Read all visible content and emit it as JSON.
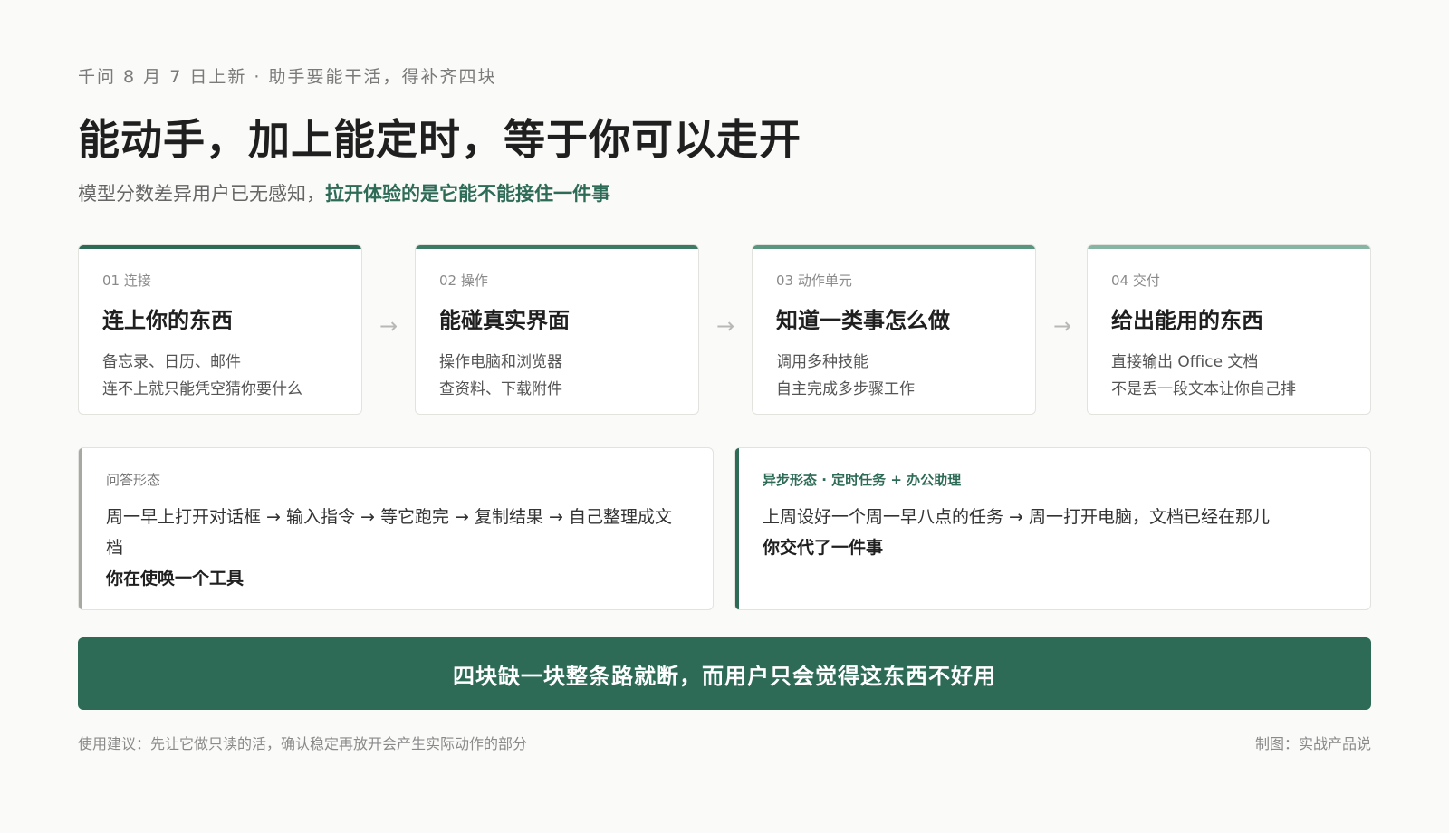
{
  "header": {
    "eyebrow": "千问 8 月 7 日上新 · 助手要能干活，得补齐四块",
    "headline": "能动手，加上能定时，等于你可以走开",
    "subline_plain": "模型分数差异用户已无感知，",
    "subline_highlight": "拉开体验的是它能不能接住一件事"
  },
  "steps": [
    {
      "tag": "01 连接",
      "title": "连上你的东西",
      "desc1": "备忘录、日历、邮件",
      "desc2": "连不上就只能凭空猜你要什么"
    },
    {
      "tag": "02 操作",
      "title": "能碰真实界面",
      "desc1": "操作电脑和浏览器",
      "desc2": "查资料、下载附件"
    },
    {
      "tag": "03 动作单元",
      "title": "知道一类事怎么做",
      "desc1": "调用多种技能",
      "desc2": "自主完成多步骤工作"
    },
    {
      "tag": "04 交付",
      "title": "给出能用的东西",
      "desc1": "直接输出 Office 文档",
      "desc2": "不是丢一段文本让你自己排"
    }
  ],
  "arrow_glyph": "→",
  "modes": {
    "qa": {
      "label": "问答形态",
      "text": "周一早上打开对话框 → 输入指令 → 等它跑完 → 复制结果 → 自己整理成文档",
      "foot": "你在使唤一个工具"
    },
    "async": {
      "label": "异步形态 · 定时任务 + 办公助理",
      "text": "上周设好一个周一早八点的任务 → 周一打开电脑，文档已经在那儿",
      "foot": "你交代了一件事"
    }
  },
  "banner": "四块缺一块整条路就断，而用户只会觉得这东西不好用",
  "footer": {
    "left": "使用建议：先让它做只读的活，确认稳定再放开会产生实际动作的部分",
    "right": "制图：实战产品说"
  },
  "colors": {
    "accent": "#2d6b57",
    "step_bars": [
      "#2d6b57",
      "#3d7a65",
      "#5a9580",
      "#86b5a4"
    ]
  }
}
